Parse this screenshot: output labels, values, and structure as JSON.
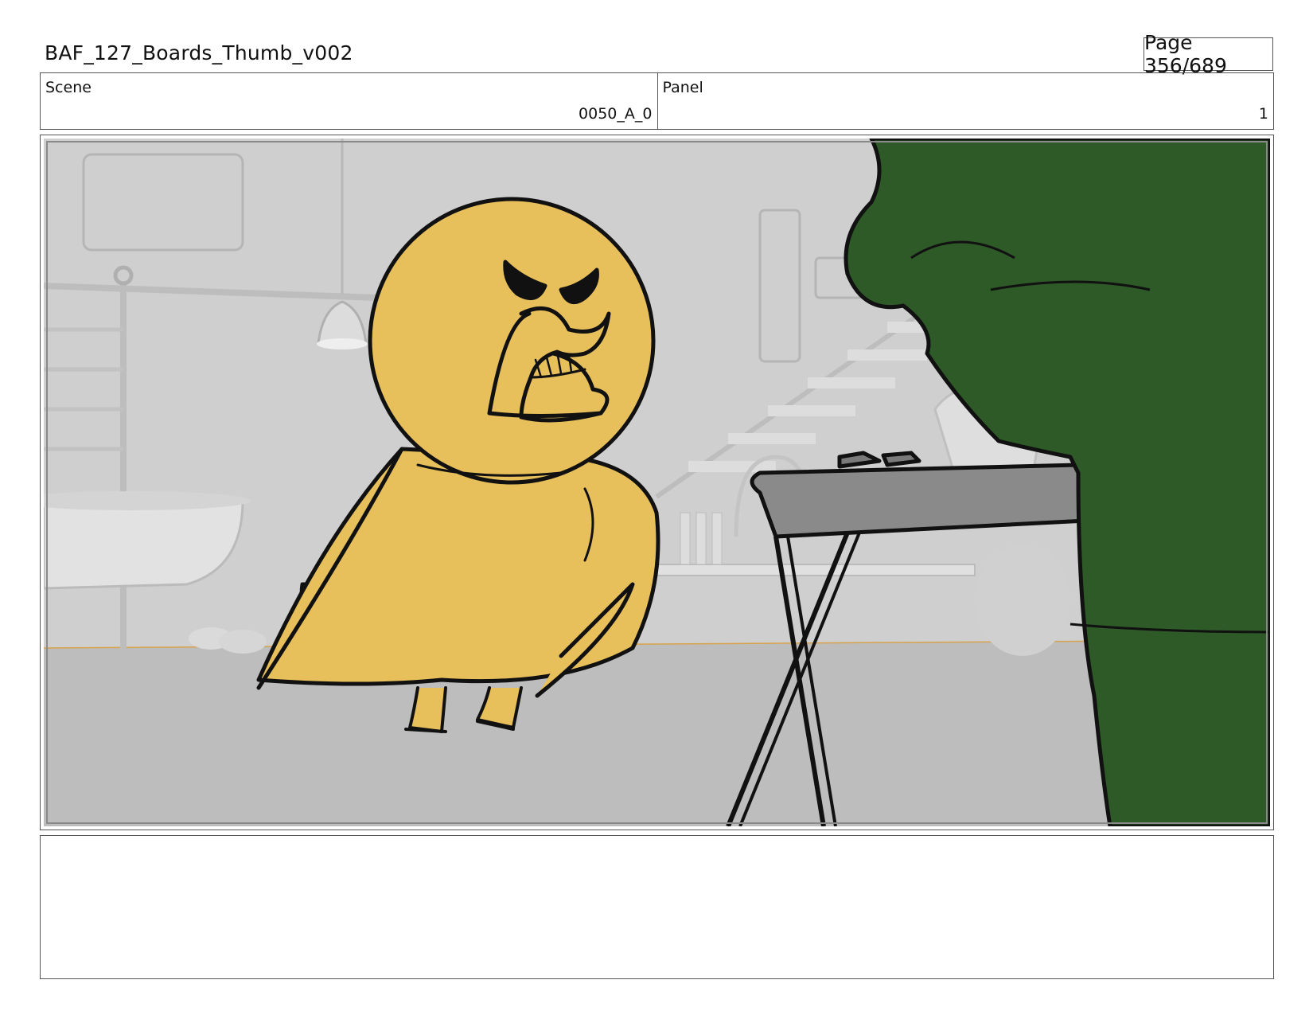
{
  "header": {
    "title": "BAF_127_Boards_Thumb_v002",
    "page_label": "Page 356/689"
  },
  "scene": {
    "label": "Scene",
    "value": "0050_A_0"
  },
  "panel": {
    "label": "Panel",
    "value": "1"
  },
  "artwork": {
    "description_colors": {
      "background": "#c9c9c9",
      "floor": "#b9b9b9",
      "bird": "#e8c05b",
      "figure": "#2d5a27",
      "stand": "#8a8a8a"
    }
  },
  "notes": {
    "text": ""
  }
}
